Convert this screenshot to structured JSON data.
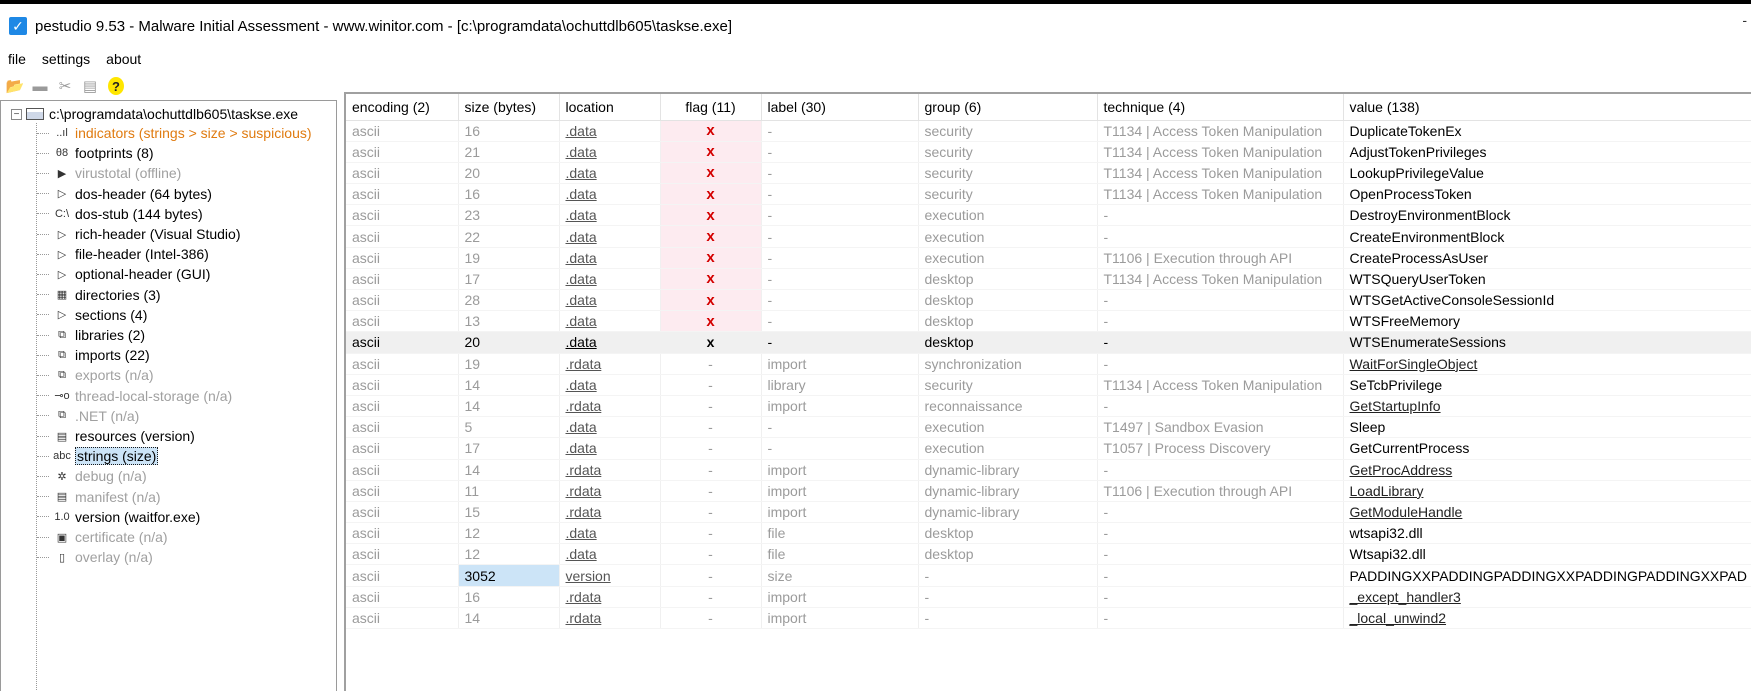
{
  "window": {
    "title": "pestudio 9.53 - Malware Initial Assessment - www.winitor.com - [c:\\programdata\\ochuttdlb605\\taskse.exe]",
    "minimize": "-"
  },
  "menu": [
    "file",
    "settings",
    "about"
  ],
  "toolbar": {
    "icons": [
      "open-icon",
      "save-icon",
      "cut-icon",
      "list-icon",
      "help-icon"
    ],
    "help_glyph": "?"
  },
  "tree": {
    "root": "c:\\programdata\\ochuttdlb605\\taskse.exe",
    "items": [
      {
        "label": "indicators (strings > size > suspicious)",
        "icon": "indicators-icon",
        "glyph": "..ıl",
        "state": "orange"
      },
      {
        "label": "footprints (8)",
        "icon": "footprints-icon",
        "glyph": "θ8",
        "state": "normal"
      },
      {
        "label": "virustotal (offline)",
        "icon": "virustotal-icon",
        "glyph": "▶",
        "state": "disabled"
      },
      {
        "label": "dos-header (64 bytes)",
        "icon": "expand-arrow-icon",
        "glyph": "▷",
        "state": "normal"
      },
      {
        "label": "dos-stub (144 bytes)",
        "icon": "console-icon",
        "glyph": "C:\\",
        "state": "normal"
      },
      {
        "label": "rich-header (Visual Studio)",
        "icon": "expand-arrow-icon",
        "glyph": "▷",
        "state": "normal"
      },
      {
        "label": "file-header (Intel-386)",
        "icon": "expand-arrow-icon",
        "glyph": "▷",
        "state": "normal"
      },
      {
        "label": "optional-header (GUI)",
        "icon": "expand-arrow-icon",
        "glyph": "▷",
        "state": "normal"
      },
      {
        "label": "directories (3)",
        "icon": "directories-icon",
        "glyph": "▦",
        "state": "normal"
      },
      {
        "label": "sections (4)",
        "icon": "expand-arrow-icon",
        "glyph": "▷",
        "state": "normal"
      },
      {
        "label": "libraries (2)",
        "icon": "library-icon",
        "glyph": "⧉",
        "state": "normal"
      },
      {
        "label": "imports (22)",
        "icon": "imports-icon",
        "glyph": "⧉",
        "state": "normal"
      },
      {
        "label": "exports (n/a)",
        "icon": "exports-icon",
        "glyph": "⧉",
        "state": "disabled"
      },
      {
        "label": "thread-local-storage (n/a)",
        "icon": "tls-icon",
        "glyph": "⊸o",
        "state": "disabled"
      },
      {
        "label": ".NET (n/a)",
        "icon": "dotnet-icon",
        "glyph": "⧉",
        "state": "disabled"
      },
      {
        "label": "resources (version)",
        "icon": "resources-icon",
        "glyph": "▤",
        "state": "normal"
      },
      {
        "label": "strings (size)",
        "icon": "strings-icon",
        "glyph": "abc",
        "state": "selected"
      },
      {
        "label": "debug (n/a)",
        "icon": "debug-bug-icon",
        "glyph": "✲",
        "state": "disabled"
      },
      {
        "label": "manifest (n/a)",
        "icon": "manifest-icon",
        "glyph": "▤",
        "state": "disabled"
      },
      {
        "label": "version (waitfor.exe)",
        "icon": "version-icon",
        "glyph": "1.0",
        "state": "normal"
      },
      {
        "label": "certificate (n/a)",
        "icon": "certificate-icon",
        "glyph": "▣",
        "state": "disabled"
      },
      {
        "label": "overlay (n/a)",
        "icon": "overlay-icon",
        "glyph": "▯",
        "state": "disabled"
      }
    ]
  },
  "table": {
    "columns": [
      "encoding (2)",
      "size (bytes)",
      "location",
      "flag (11)",
      "label (30)",
      "group (6)",
      "technique (4)",
      "value (138)"
    ],
    "rows": [
      {
        "encoding": "ascii",
        "size": "16",
        "location": ".data",
        "flag": "x",
        "label": "-",
        "group": "security",
        "technique": "T1134 | Access Token Manipulation",
        "value": "DuplicateTokenEx",
        "link": false
      },
      {
        "encoding": "ascii",
        "size": "21",
        "location": ".data",
        "flag": "x",
        "label": "-",
        "group": "security",
        "technique": "T1134 | Access Token Manipulation",
        "value": "AdjustTokenPrivileges",
        "link": false
      },
      {
        "encoding": "ascii",
        "size": "20",
        "location": ".data",
        "flag": "x",
        "label": "-",
        "group": "security",
        "technique": "T1134 | Access Token Manipulation",
        "value": "LookupPrivilegeValue",
        "link": false
      },
      {
        "encoding": "ascii",
        "size": "16",
        "location": ".data",
        "flag": "x",
        "label": "-",
        "group": "security",
        "technique": "T1134 | Access Token Manipulation",
        "value": "OpenProcessToken",
        "link": false
      },
      {
        "encoding": "ascii",
        "size": "23",
        "location": ".data",
        "flag": "x",
        "label": "-",
        "group": "execution",
        "technique": "-",
        "value": "DestroyEnvironmentBlock",
        "link": false
      },
      {
        "encoding": "ascii",
        "size": "22",
        "location": ".data",
        "flag": "x",
        "label": "-",
        "group": "execution",
        "technique": "-",
        "value": "CreateEnvironmentBlock",
        "link": false
      },
      {
        "encoding": "ascii",
        "size": "19",
        "location": ".data",
        "flag": "x",
        "label": "-",
        "group": "execution",
        "technique": "T1106 | Execution through API",
        "value": "CreateProcessAsUser",
        "link": false
      },
      {
        "encoding": "ascii",
        "size": "17",
        "location": ".data",
        "flag": "x",
        "label": "-",
        "group": "desktop",
        "technique": "T1134 | Access Token Manipulation",
        "value": "WTSQueryUserToken",
        "link": false
      },
      {
        "encoding": "ascii",
        "size": "28",
        "location": ".data",
        "flag": "x",
        "label": "-",
        "group": "desktop",
        "technique": "-",
        "value": "WTSGetActiveConsoleSessionId",
        "link": false
      },
      {
        "encoding": "ascii",
        "size": "13",
        "location": ".data",
        "flag": "x",
        "label": "-",
        "group": "desktop",
        "technique": "-",
        "value": "WTSFreeMemory",
        "link": false
      },
      {
        "encoding": "ascii",
        "size": "20",
        "location": ".data",
        "flag": "x",
        "label": "-",
        "group": "desktop",
        "technique": "-",
        "value": "WTSEnumerateSessions",
        "link": false,
        "highlight": true
      },
      {
        "encoding": "ascii",
        "size": "19",
        "location": ".rdata",
        "flag": "-",
        "label": "import",
        "group": "synchronization",
        "technique": "-",
        "value": "WaitForSingleObject",
        "link": true
      },
      {
        "encoding": "ascii",
        "size": "14",
        "location": ".data",
        "flag": "-",
        "label": "library",
        "group": "security",
        "technique": "T1134 | Access Token Manipulation",
        "value": "SeTcbPrivilege",
        "link": false
      },
      {
        "encoding": "ascii",
        "size": "14",
        "location": ".rdata",
        "flag": "-",
        "label": "import",
        "group": "reconnaissance",
        "technique": "-",
        "value": "GetStartupInfo",
        "link": true
      },
      {
        "encoding": "ascii",
        "size": "5",
        "location": ".data",
        "flag": "-",
        "label": "-",
        "group": "execution",
        "technique": "T1497 | Sandbox Evasion",
        "value": "Sleep",
        "link": false
      },
      {
        "encoding": "ascii",
        "size": "17",
        "location": ".data",
        "flag": "-",
        "label": "-",
        "group": "execution",
        "technique": "T1057 | Process Discovery",
        "value": "GetCurrentProcess",
        "link": false
      },
      {
        "encoding": "ascii",
        "size": "14",
        "location": ".rdata",
        "flag": "-",
        "label": "import",
        "group": "dynamic-library",
        "technique": "-",
        "value": "GetProcAddress",
        "link": true
      },
      {
        "encoding": "ascii",
        "size": "11",
        "location": ".rdata",
        "flag": "-",
        "label": "import",
        "group": "dynamic-library",
        "technique": "T1106 | Execution through API",
        "value": "LoadLibrary",
        "link": true
      },
      {
        "encoding": "ascii",
        "size": "15",
        "location": ".rdata",
        "flag": "-",
        "label": "import",
        "group": "dynamic-library",
        "technique": "-",
        "value": "GetModuleHandle",
        "link": true
      },
      {
        "encoding": "ascii",
        "size": "12",
        "location": ".data",
        "flag": "-",
        "label": "file",
        "group": "desktop",
        "technique": "-",
        "value": "wtsapi32.dll",
        "link": false
      },
      {
        "encoding": "ascii",
        "size": "12",
        "location": ".data",
        "flag": "-",
        "label": "file",
        "group": "desktop",
        "technique": "-",
        "value": "Wtsapi32.dll",
        "link": false
      },
      {
        "encoding": "ascii",
        "size": "3052",
        "location": "version",
        "flag": "-",
        "label": "size",
        "group": "-",
        "technique": "-",
        "value": "PADDINGXXPADDINGPADDINGXXPADDINGPADDINGXXPAD",
        "link": false,
        "size_selected": true
      },
      {
        "encoding": "ascii",
        "size": "16",
        "location": ".rdata",
        "flag": "-",
        "label": "import",
        "group": "-",
        "technique": "-",
        "value": "_except_handler3",
        "link": true
      },
      {
        "encoding": "ascii",
        "size": "14",
        "location": ".rdata",
        "flag": "-",
        "label": "import",
        "group": "-",
        "technique": "-",
        "value": "_local_unwind2",
        "link": true
      }
    ]
  }
}
